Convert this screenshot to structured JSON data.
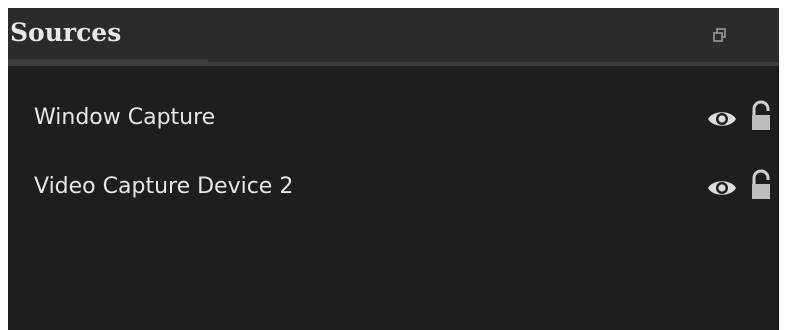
{
  "panel": {
    "title": "Sources",
    "float_icon": "float-dock-icon"
  },
  "sources": [
    {
      "label": "Window Capture",
      "visibility_icon": "eye-icon",
      "lock_icon": "unlocked-padlock-icon"
    },
    {
      "label": "Video Capture Device 2",
      "visibility_icon": "eye-icon",
      "lock_icon": "unlocked-padlock-icon"
    }
  ],
  "colors": {
    "panel_bg": "#1e1e1e",
    "titlebar_bg": "#2b2b2b",
    "text": "#e6e6e6",
    "icon": "#d9d9d9"
  }
}
